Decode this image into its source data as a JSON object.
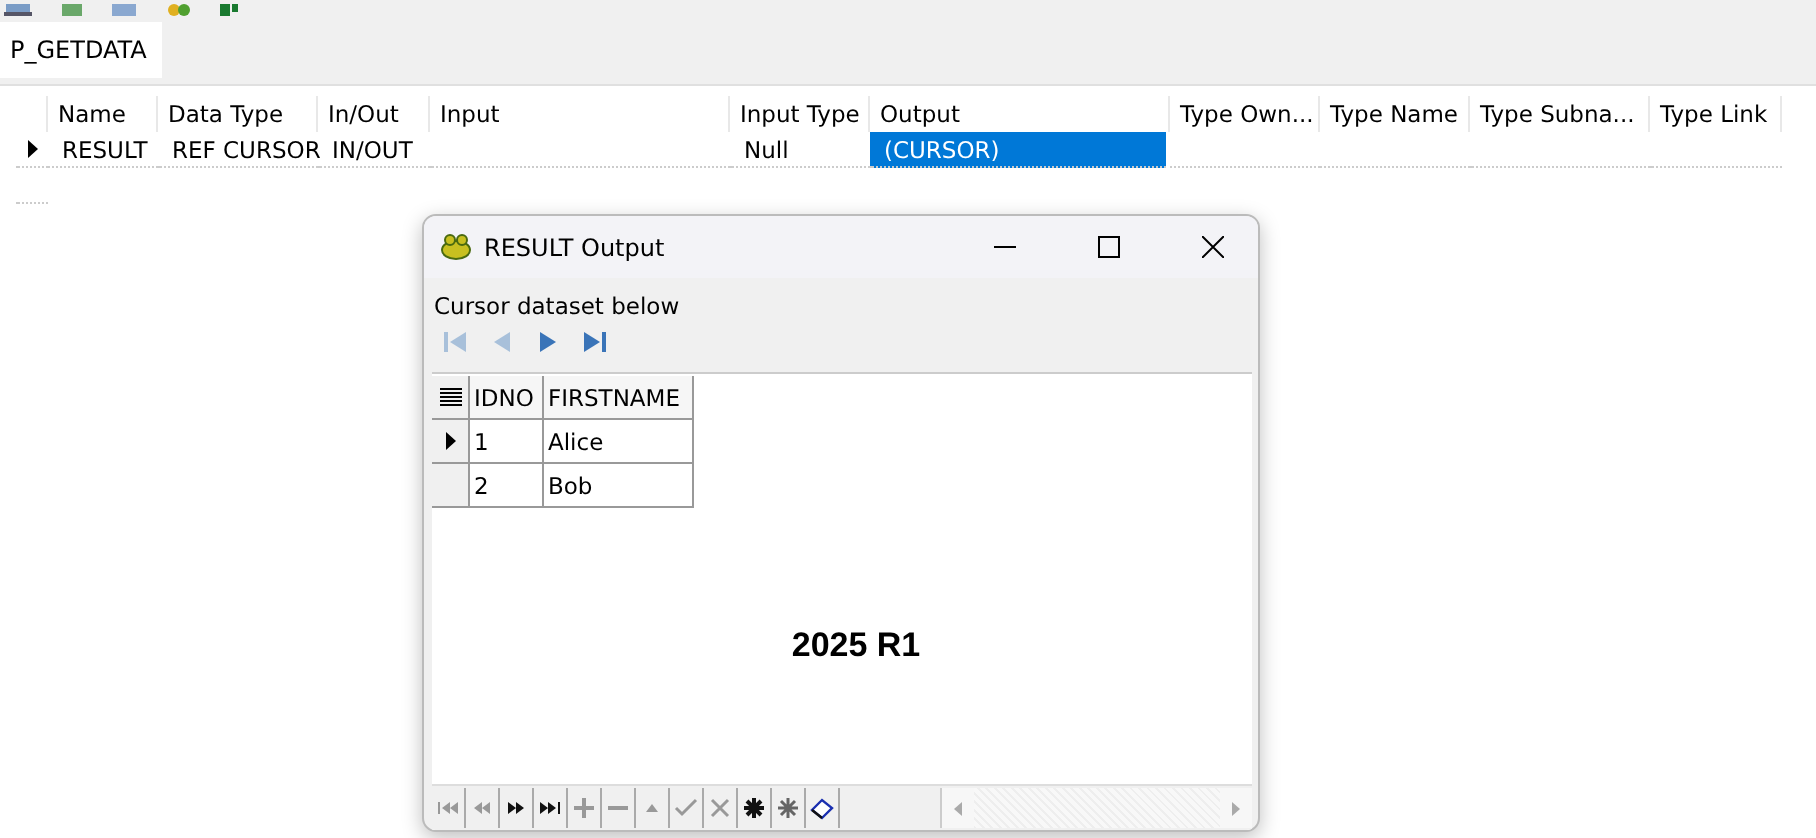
{
  "tabs": [
    {
      "label": "P_GETDATA",
      "selected": true
    }
  ],
  "params_grid": {
    "columns": [
      "Name",
      "Data Type",
      "In/Out",
      "Input",
      "Input Type",
      "Output",
      "Type Own...",
      "Type Name",
      "Type Subna...",
      "Type Link"
    ],
    "rows": [
      {
        "current": true,
        "cells": [
          {
            "text": "RESULT",
            "selected": false
          },
          {
            "text": "REF CURSOR",
            "selected": false
          },
          {
            "text": "IN/OUT",
            "selected": false
          },
          {
            "selected": false
          },
          {
            "text": "Null",
            "selected": false
          },
          {
            "text": "(CURSOR)",
            "selected": true
          },
          {
            "selected": false
          },
          {
            "selected": false
          },
          {
            "selected": false
          },
          {
            "selected": false
          }
        ]
      }
    ]
  },
  "dialog": {
    "title": "RESULT Output",
    "caption": "Cursor dataset below",
    "nav": [
      {
        "kind": "first",
        "disabled": true
      },
      {
        "kind": "prior",
        "disabled": true
      },
      {
        "kind": "next",
        "disabled": false
      },
      {
        "kind": "last",
        "disabled": false
      }
    ],
    "grid": {
      "columns": [
        "IDNO",
        "FIRSTNAME"
      ],
      "rows": [
        {
          "current": true,
          "cells": [
            "1",
            "Alice"
          ]
        },
        {
          "current": false,
          "cells": [
            "2",
            "Bob"
          ]
        }
      ]
    },
    "watermark_text": "2025 R1",
    "navigator": [
      {
        "kind": "first",
        "disabled": true
      },
      {
        "kind": "prior",
        "disabled": true
      },
      {
        "kind": "next",
        "disabled": false
      },
      {
        "kind": "last",
        "disabled": false
      },
      {
        "kind": "insert",
        "disabled": true
      },
      {
        "kind": "delete",
        "disabled": true
      },
      {
        "kind": "edit",
        "disabled": true
      },
      {
        "kind": "post",
        "disabled": true
      },
      {
        "kind": "cancel",
        "disabled": true
      },
      {
        "kind": "refresh",
        "disabled": false
      },
      {
        "kind": "refresh-grey",
        "disabled": false
      },
      {
        "kind": "clear",
        "disabled": false
      }
    ]
  }
}
